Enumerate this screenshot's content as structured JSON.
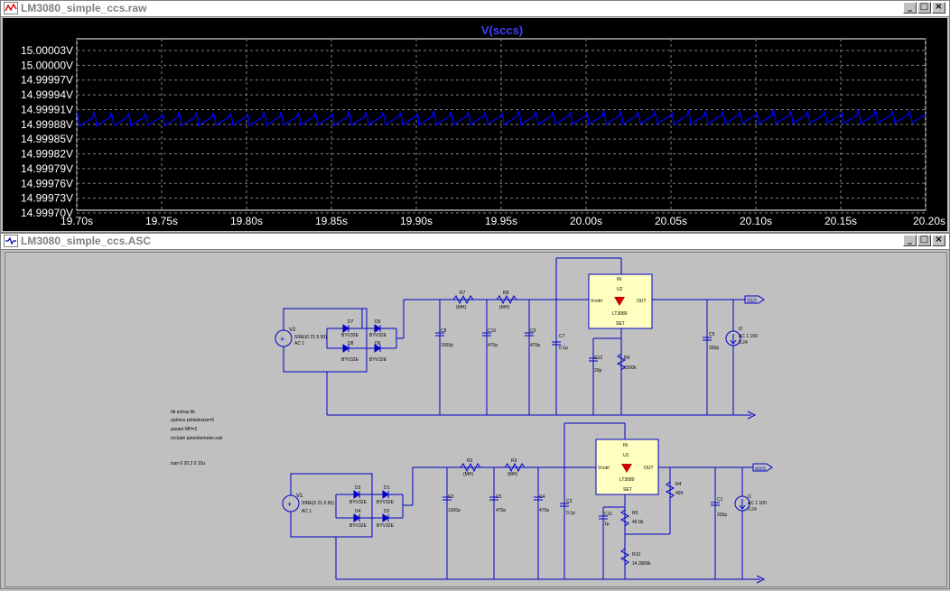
{
  "waveform_window": {
    "title": "LM3080_simple_ccs.raw",
    "trace_label": "V(sccs)",
    "trace_color": "#0000ff",
    "y_ticks": [
      "15.00003V",
      "15.00000V",
      "14.99997V",
      "14.99994V",
      "14.99991V",
      "14.99988V",
      "14.99985V",
      "14.99982V",
      "14.99979V",
      "14.99976V",
      "14.99973V",
      "14.99970V"
    ],
    "x_ticks": [
      "19.70s",
      "19.75s",
      "19.80s",
      "19.85s",
      "19.90s",
      "19.95s",
      "20.00s",
      "20.05s",
      "20.10s",
      "20.15s",
      "20.20s"
    ],
    "buttons": {
      "minimize": "_",
      "maximize": "□",
      "close": "×"
    }
  },
  "schematic_window": {
    "title": "LM3080_simple_ccs.ASC",
    "buttons": {
      "minimize": "_",
      "maximize": "□",
      "close": "×"
    },
    "directives": [
      ".lib extras.lib",
      ".options plotwinsize=0",
      ".param MH=2",
      ".include potentiometer.sub",
      "",
      ".tran 0 20.2 0 10u"
    ],
    "top": {
      "source": {
        "name": "V2",
        "value": "SINE(0 21.5 50)",
        "ac": "AC 1"
      },
      "diodes": [
        {
          "name": "D7",
          "model": "BYV32E"
        },
        {
          "name": "D5",
          "model": "BYV32E"
        },
        {
          "name": "D8",
          "model": "BYV32E"
        },
        {
          "name": "D6",
          "model": "BYV32E"
        }
      ],
      "resistors": [
        {
          "name": "R7",
          "value": "{MH}"
        },
        {
          "name": "R8",
          "value": "{MH}"
        },
        {
          "name": "R9",
          "value": "1500k"
        }
      ],
      "caps": [
        {
          "name": "C8",
          "value": "1000p"
        },
        {
          "name": "C10",
          "value": "470p"
        },
        {
          "name": "C9",
          "value": "470p"
        },
        {
          "name": "C7",
          "value": "0.1p"
        },
        {
          "name": "C12",
          "value": "20p"
        },
        {
          "name": "C5",
          "value": "330p"
        }
      ],
      "chip": {
        "name": "U2",
        "part": "LT3080",
        "pin_in": "IN",
        "pin_ctrl": "Vcntrl",
        "pin_out": "OUT",
        "pin_set": "SET"
      },
      "load": {
        "name": "I2",
        "value": "AC 1 100",
        "value2": "0.24"
      },
      "net_label": "S10"
    },
    "bottom": {
      "source": {
        "name": "V1",
        "value": "SINE(0 21.5 50)",
        "ac": "AC 1"
      },
      "diodes": [
        {
          "name": "D3",
          "model": "BYV32E"
        },
        {
          "name": "D1",
          "model": "BYV32E"
        },
        {
          "name": "D4",
          "model": "BYV32E"
        },
        {
          "name": "D2",
          "model": "BYV32E"
        }
      ],
      "resistors": [
        {
          "name": "R2",
          "value": "{MH}"
        },
        {
          "name": "R3",
          "value": "{MH}"
        },
        {
          "name": "R4",
          "value": "499"
        },
        {
          "name": "R5",
          "value": "49.9k"
        },
        {
          "name": "R10",
          "value": "14.3909k"
        }
      ],
      "caps": [
        {
          "name": "C3",
          "value": "1000p"
        },
        {
          "name": "C5",
          "value": "470p"
        },
        {
          "name": "C4",
          "value": "470p"
        },
        {
          "name": "C2",
          "value": "0.1p"
        },
        {
          "name": "C11",
          "value": "1p"
        },
        {
          "name": "C1",
          "value": "330p"
        }
      ],
      "chip": {
        "name": "U1",
        "part": "LT3080",
        "pin_in": "IN",
        "pin_ctrl": "Vcntrl",
        "pin_out": "OUT",
        "pin_set": "SET"
      },
      "load": {
        "name": "I1",
        "value": "AC 1 100",
        "value2": "0.24"
      },
      "net_label": "sccs"
    }
  }
}
